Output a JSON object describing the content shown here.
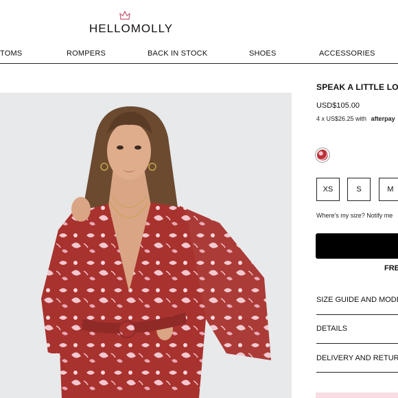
{
  "header": {
    "logo_text": "HELLOMOLLY"
  },
  "nav": {
    "items": [
      "TOMS",
      "ROMPERS",
      "BACK IN STOCK",
      "SHOES",
      "ACCESSORIES"
    ]
  },
  "product": {
    "title": "SPEAK A LITTLE LOU",
    "price": "USD$105.00",
    "installment_text": "4 x US$26.25 with",
    "afterpay_label": "afterpay",
    "sizes": [
      "XS",
      "S",
      "M"
    ],
    "size_help": "Where's my size? Notify me",
    "free_text": "FRE",
    "accordion": [
      "SIZE GUIDE AND MODEL",
      "DETAILS",
      "DELIVERY AND RETURN"
    ]
  },
  "colors": {
    "dress_red": "#a8322e",
    "dress_pink": "#f3c7cf",
    "image_bg": "#e7e9ea"
  }
}
